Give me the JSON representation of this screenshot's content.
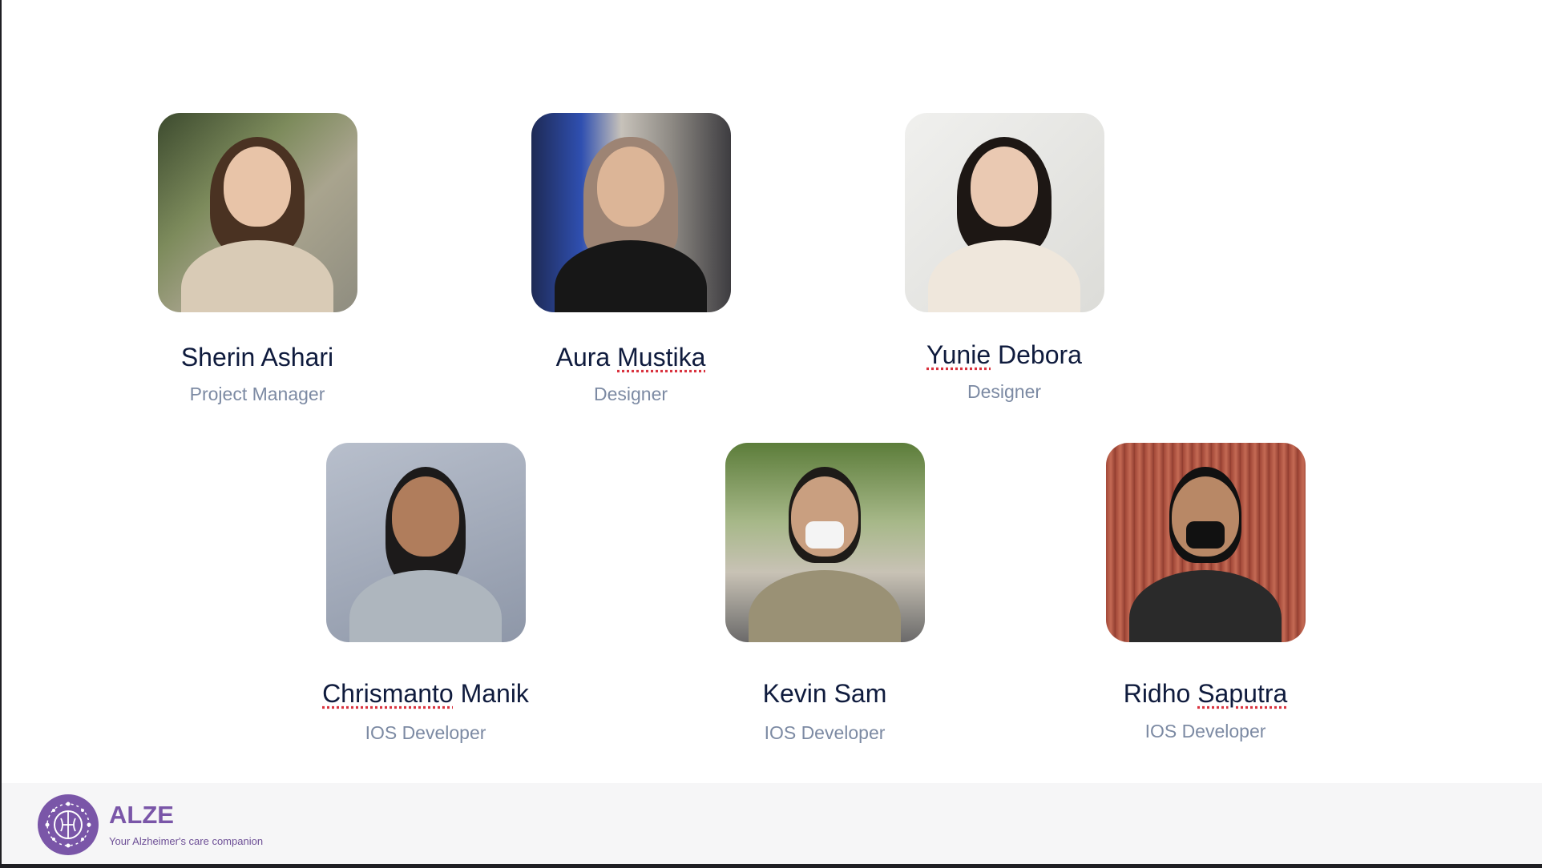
{
  "team": {
    "row1": [
      {
        "name_parts": [
          "Sherin Ashari"
        ],
        "role": "Project Manager"
      },
      {
        "name_parts": [
          "Aura ",
          "Mustika"
        ],
        "role": "Designer"
      },
      {
        "name_parts": [
          "Yunie",
          " Debora"
        ],
        "role": "Designer"
      }
    ],
    "row2": [
      {
        "name_parts": [
          "Chrismanto",
          " Manik"
        ],
        "role": "IOS Developer"
      },
      {
        "name_parts": [
          "Kevin Sam"
        ],
        "role": "IOS Developer"
      },
      {
        "name_parts": [
          "Ridho ",
          "Saputra"
        ],
        "role": "IOS Developer"
      }
    ]
  },
  "footer": {
    "brand": "ALZE",
    "tagline": "Your Alzheimer's care companion"
  },
  "colors": {
    "brand": "#7a56a8",
    "name_text": "#0f1b3d",
    "role_text": "#7c8aa3",
    "footer_bg": "#f6f6f7"
  }
}
